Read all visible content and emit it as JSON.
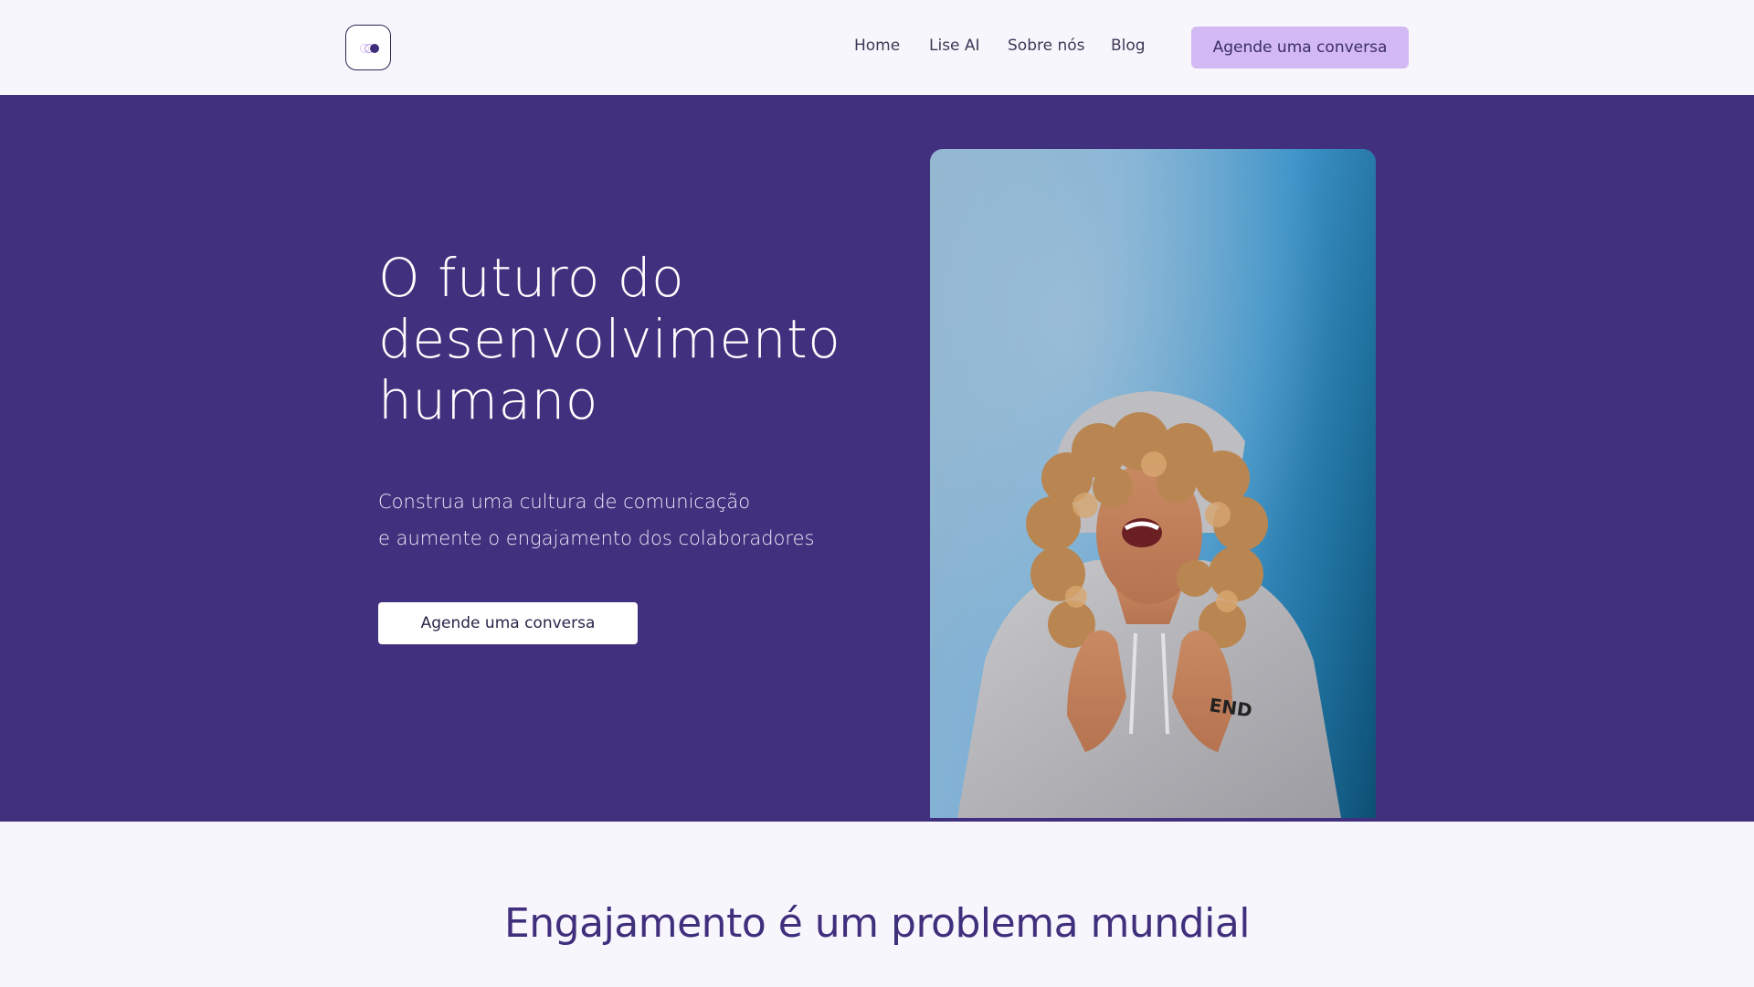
{
  "header": {
    "nav": [
      "Home",
      "Lise AI",
      "Sobre nós",
      "Blog"
    ],
    "cta_label": "Agende uma conversa"
  },
  "hero": {
    "title": "O futuro do desenvolvimento humano",
    "subtitle_lines": [
      "Construa uma cultura de comunicação",
      "e aumente o engajamento dos colaboradores"
    ],
    "cta_label": "Agende uma conversa",
    "sweatshirt_text": "END"
  },
  "section": {
    "title": "Engajamento é um problema mundial"
  },
  "colors": {
    "hero_background": "#41307d",
    "page_background": "#f8f6fd",
    "header_cta_background": "#d2b9f3",
    "accent_text": "#3f2f7c"
  },
  "icons": {
    "logo": "logo-icon"
  }
}
